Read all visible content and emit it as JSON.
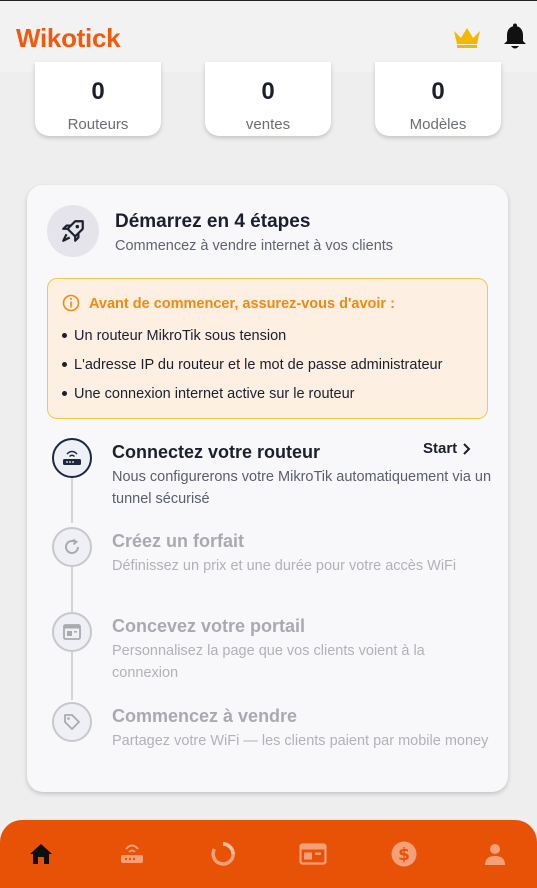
{
  "app": {
    "title": "Wikotick"
  },
  "stats": [
    {
      "value": "0",
      "label": "Routeurs"
    },
    {
      "value": "0",
      "label": "ventes"
    },
    {
      "value": "0",
      "label": "Modèles"
    }
  ],
  "onboarding": {
    "title": "Démarrez en 4 étapes",
    "subtitle": "Commencez à vendre internet à vos clients",
    "notice": {
      "title": "Avant de commencer, assurez-vous d'avoir :",
      "items": [
        "Un routeur MikroTik sous tension",
        "L'adresse IP du routeur et le mot de passe administrateur",
        "Une connexion internet active sur le routeur"
      ]
    },
    "steps": [
      {
        "title": "Connectez votre routeur",
        "desc": "Nous configurerons votre MikroTik automatiquement via un tunnel sécurisé",
        "icon": "router-icon"
      },
      {
        "title": "Créez un forfait",
        "desc": "Définissez un prix et une durée pour votre accès WiFi",
        "icon": "refresh-icon"
      },
      {
        "title": "Concevez votre portail",
        "desc": "Personnalisez la page que vos clients voient à la connexion",
        "icon": "browser-icon"
      },
      {
        "title": "Commencez à vendre",
        "desc": "Partagez votre WiFi — les clients paient par mobile money",
        "icon": "tag-icon"
      }
    ],
    "start_label": "Start"
  },
  "nav": [
    "home-icon",
    "router-icon",
    "spinner-icon",
    "browser-icon",
    "dollar-icon",
    "user-icon"
  ],
  "colors": {
    "brand": "#f25a0b",
    "nav_bg": "#e85206",
    "notice_title": "#f08a10",
    "crown": "#f5b800"
  }
}
